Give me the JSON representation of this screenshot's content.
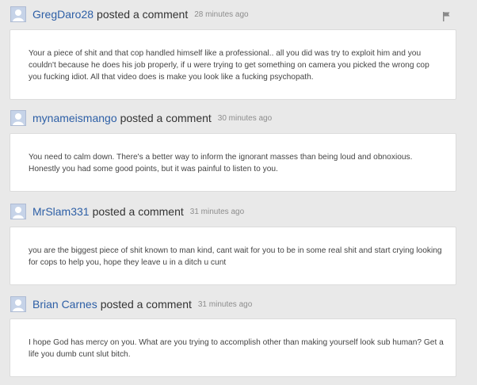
{
  "comments": [
    {
      "username": "GregDaro28",
      "action": "posted a comment",
      "timestamp": "28 minutes ago",
      "text": "Your a piece of shit and that cop handled himself like a professional.. all you did was try to exploit him and you couldn't because he does his job properly, if u were trying to get something on camera you picked the wrong cop you fucking idiot. All that video does is make you look like a fucking psychopath."
    },
    {
      "username": "mynameismango",
      "action": "posted a comment",
      "timestamp": "30 minutes ago",
      "text": "You need to calm down. There's a better way to inform the ignorant masses than being loud and obnoxious. Honestly you had some good points, but it was painful to listen to you."
    },
    {
      "username": "MrSlam331",
      "action": "posted a comment",
      "timestamp": "31 minutes ago",
      "text": "you are the biggest piece of shit known to man kind, cant wait for you to be in some real shit and start crying looking for cops to help you, hope they leave u in a ditch u cunt"
    },
    {
      "username": "Brian Carnes",
      "action": "posted a comment",
      "timestamp": "31 minutes ago",
      "text": "I hope God has mercy on you. What are you trying to accomplish other than making yourself look sub human? Get a life you dumb cunt slut bitch."
    }
  ],
  "icons": {
    "avatar": "default-user-icon",
    "flag": "flag-icon"
  },
  "colors": {
    "background": "#e9e9e9",
    "username": "#2d5fa6",
    "timestamp": "#8d8d8d",
    "bubble": "#ffffff",
    "avatar": "#c6d3e8"
  }
}
